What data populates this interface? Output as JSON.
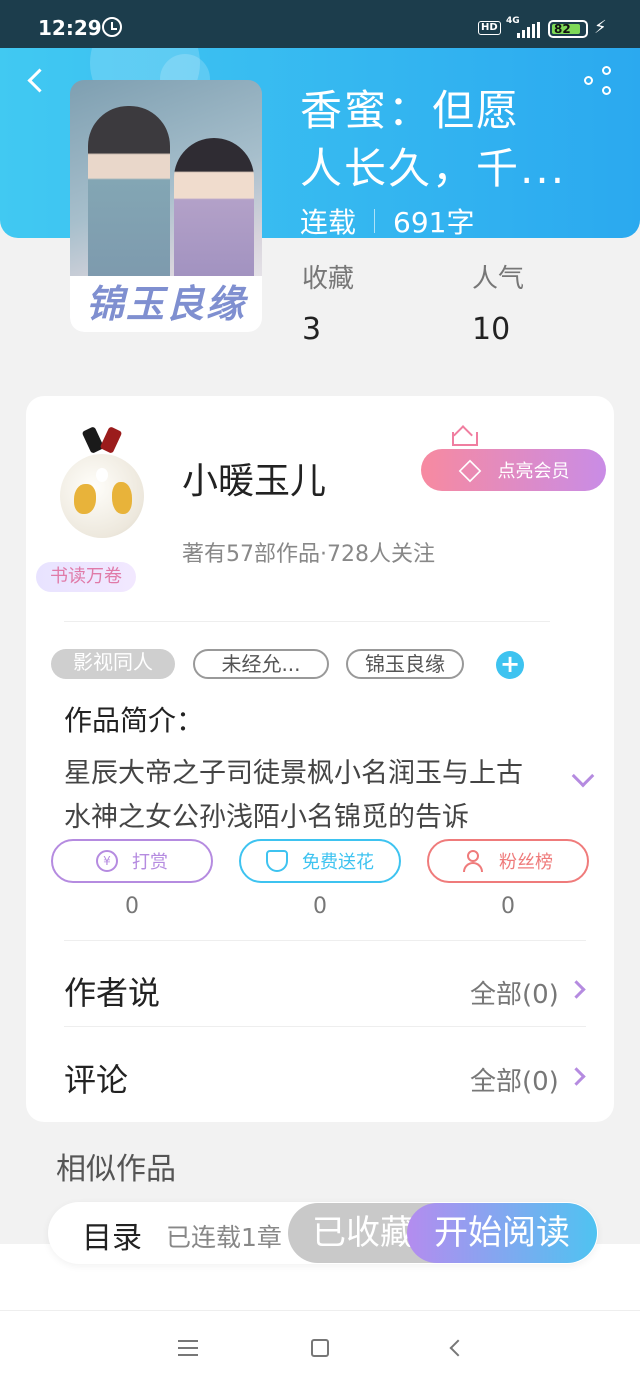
{
  "status_bar": {
    "time": "12:29",
    "hd": "HD",
    "network": "4G",
    "battery": "82"
  },
  "book": {
    "title_line1": "香蜜：但愿",
    "title_line2": "人长久，千...",
    "status": "连载",
    "word_count": "691字",
    "cover_title": "锦玉良缘",
    "stats": [
      {
        "label": "收藏",
        "value": "3"
      },
      {
        "label": "人气",
        "value": "10"
      }
    ]
  },
  "author": {
    "name": "小暖玉儿",
    "badge": "书读万卷",
    "stats": "著有57部作品·728人关注",
    "vip_label": "点亮会员"
  },
  "tags": [
    "影视同人",
    "未经允...",
    "锦玉良缘"
  ],
  "intro": {
    "label": "作品简介：",
    "text": "星辰大帝之子司徒景枫小名润玉与上古水神之女公孙浅陌小名锦觅的告诉"
  },
  "actions": [
    {
      "label": "打赏",
      "count": "0",
      "icon": "yuan-icon",
      "color": "#b58be0"
    },
    {
      "label": "免费送花",
      "count": "0",
      "icon": "flower-icon",
      "color": "#3ec3f0"
    },
    {
      "label": "粉丝榜",
      "count": "0",
      "icon": "fans-icon",
      "color": "#ef7b7b"
    }
  ],
  "rows": [
    {
      "label": "作者说",
      "value": "全部(0)"
    },
    {
      "label": "评论",
      "value": "全部(0)"
    }
  ],
  "similar_label": "相似作品",
  "bottom": {
    "catalog": "目录",
    "serial": "已连载1章",
    "collected": "已收藏",
    "read": "开始阅读"
  },
  "colors": {
    "header": "#2ba9ef",
    "accent_purple": "#b58be0",
    "accent_blue": "#3ec3f0"
  }
}
